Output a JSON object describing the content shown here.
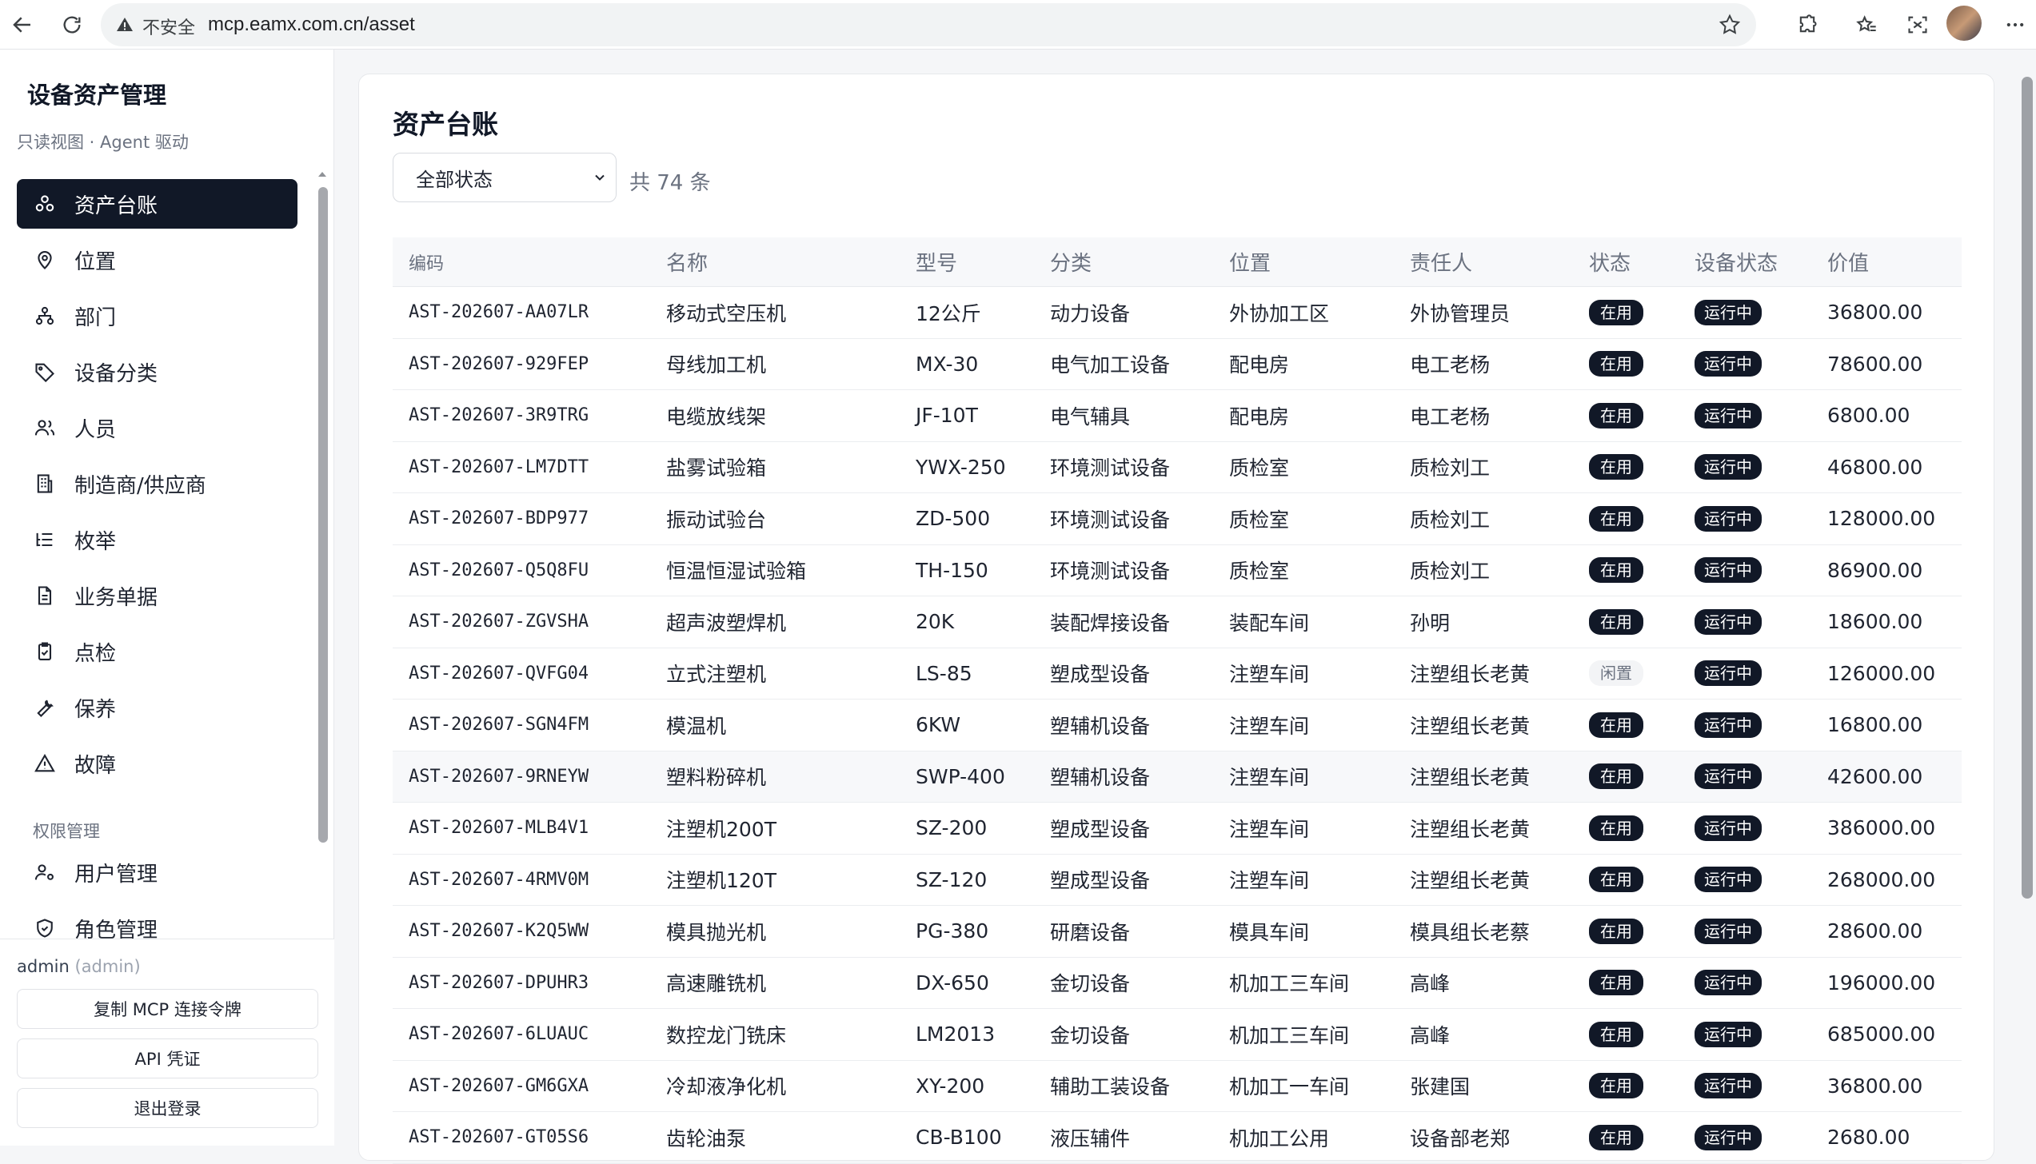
{
  "browser": {
    "insecure_label": "不安全",
    "url": "mcp.eamx.com.cn/asset"
  },
  "sidebar": {
    "brand": "设备资产管理",
    "subtitle": "只读视图 · Agent 驱动",
    "items": [
      {
        "label": "资产台账",
        "icon": "assets-icon",
        "active": true
      },
      {
        "label": "位置",
        "icon": "location-pin-icon"
      },
      {
        "label": "部门",
        "icon": "org-tree-icon"
      },
      {
        "label": "设备分类",
        "icon": "tag-icon"
      },
      {
        "label": "人员",
        "icon": "people-icon"
      },
      {
        "label": "制造商/供应商",
        "icon": "building-icon"
      },
      {
        "label": "枚举",
        "icon": "list-icon"
      },
      {
        "label": "业务单据",
        "icon": "document-icon"
      },
      {
        "label": "点检",
        "icon": "clipboard-check-icon"
      },
      {
        "label": "保养",
        "icon": "wrench-icon"
      },
      {
        "label": "故障",
        "icon": "warning-icon"
      }
    ],
    "section_label": "权限管理",
    "perm_items": [
      {
        "label": "用户管理",
        "icon": "user-gear-icon"
      },
      {
        "label": "角色管理",
        "icon": "shield-icon"
      }
    ],
    "footer": {
      "user": "admin",
      "role": "(admin)",
      "copy_token": "复制 MCP 连接令牌",
      "api_credentials": "API 凭证",
      "logout": "退出登录"
    }
  },
  "main": {
    "title": "资产台账",
    "filter_value": "全部状态",
    "count_text": "共 74 条",
    "columns": [
      "编码",
      "名称",
      "型号",
      "分类",
      "位置",
      "责任人",
      "状态",
      "设备状态",
      "价值"
    ],
    "rows": [
      [
        "AST-202607-AA07LR",
        "移动式空压机",
        "12公斤",
        "动力设备",
        "外协加工区",
        "外协管理员",
        "在用",
        "运行中",
        "36800.00"
      ],
      [
        "AST-202607-929FEP",
        "母线加工机",
        "MX-30",
        "电气加工设备",
        "配电房",
        "电工老杨",
        "在用",
        "运行中",
        "78600.00"
      ],
      [
        "AST-202607-3R9TRG",
        "电缆放线架",
        "JF-10T",
        "电气辅具",
        "配电房",
        "电工老杨",
        "在用",
        "运行中",
        "6800.00"
      ],
      [
        "AST-202607-LM7DTT",
        "盐雾试验箱",
        "YWX-250",
        "环境测试设备",
        "质检室",
        "质检刘工",
        "在用",
        "运行中",
        "46800.00"
      ],
      [
        "AST-202607-BDP977",
        "振动试验台",
        "ZD-500",
        "环境测试设备",
        "质检室",
        "质检刘工",
        "在用",
        "运行中",
        "128000.00"
      ],
      [
        "AST-202607-Q5Q8FU",
        "恒温恒湿试验箱",
        "TH-150",
        "环境测试设备",
        "质检室",
        "质检刘工",
        "在用",
        "运行中",
        "86900.00"
      ],
      [
        "AST-202607-ZGVSHA",
        "超声波塑焊机",
        "20K",
        "装配焊接设备",
        "装配车间",
        "孙明",
        "在用",
        "运行中",
        "18600.00"
      ],
      [
        "AST-202607-QVFG04",
        "立式注塑机",
        "LS-85",
        "塑成型设备",
        "注塑车间",
        "注塑组长老黄",
        "闲置",
        "运行中",
        "126000.00"
      ],
      [
        "AST-202607-SGN4FM",
        "模温机",
        "6KW",
        "塑辅机设备",
        "注塑车间",
        "注塑组长老黄",
        "在用",
        "运行中",
        "16800.00"
      ],
      [
        "AST-202607-9RNEYW",
        "塑料粉碎机",
        "SWP-400",
        "塑辅机设备",
        "注塑车间",
        "注塑组长老黄",
        "在用",
        "运行中",
        "42600.00"
      ],
      [
        "AST-202607-MLB4V1",
        "注塑机200T",
        "SZ-200",
        "塑成型设备",
        "注塑车间",
        "注塑组长老黄",
        "在用",
        "运行中",
        "386000.00"
      ],
      [
        "AST-202607-4RMV0M",
        "注塑机120T",
        "SZ-120",
        "塑成型设备",
        "注塑车间",
        "注塑组长老黄",
        "在用",
        "运行中",
        "268000.00"
      ],
      [
        "AST-202607-K2Q5WW",
        "模具抛光机",
        "PG-380",
        "研磨设备",
        "模具车间",
        "模具组长老蔡",
        "在用",
        "运行中",
        "28600.00"
      ],
      [
        "AST-202607-DPUHR3",
        "高速雕铣机",
        "DX-650",
        "金切设备",
        "机加工三车间",
        "高峰",
        "在用",
        "运行中",
        "196000.00"
      ],
      [
        "AST-202607-6LUAUC",
        "数控龙门铣床",
        "LM2013",
        "金切设备",
        "机加工三车间",
        "高峰",
        "在用",
        "运行中",
        "685000.00"
      ],
      [
        "AST-202607-GM6GXA",
        "冷却液净化机",
        "XY-200",
        "辅助工装设备",
        "机加工一车间",
        "张建国",
        "在用",
        "运行中",
        "36800.00"
      ],
      [
        "AST-202607-GT05S6",
        "齿轮油泵",
        "CB-B100",
        "液压辅件",
        "机加工公用",
        "设备部老郑",
        "在用",
        "运行中",
        "2680.00"
      ]
    ]
  }
}
